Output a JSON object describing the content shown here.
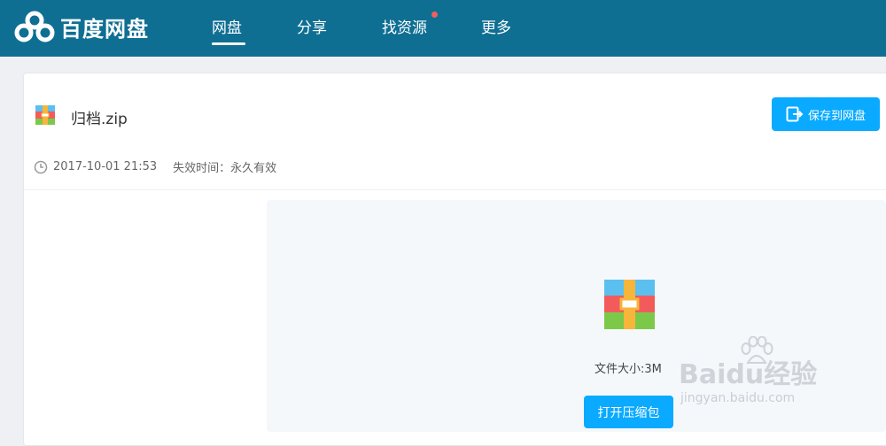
{
  "app": {
    "logo_text": "百度网盘",
    "brand_color": "#0f6f93",
    "accent_color": "#09aaff"
  },
  "nav": {
    "items": [
      {
        "label": "网盘",
        "active": true
      },
      {
        "label": "分享",
        "active": false
      },
      {
        "label": "找资源",
        "active": false,
        "badge_dot": true
      },
      {
        "label": "更多",
        "active": false
      }
    ]
  },
  "file": {
    "name": "归档.zip",
    "icon": "zip-archive-icon",
    "date": "2017-10-01 21:53",
    "expiry": "失效时间：永久有效",
    "size": "文件大小:3M"
  },
  "actions": {
    "save_label": "保存到网盘",
    "open_label": "打开压缩包"
  },
  "watermark": {
    "main": "Baidu经验",
    "sub": "jingyan.baidu.com"
  }
}
